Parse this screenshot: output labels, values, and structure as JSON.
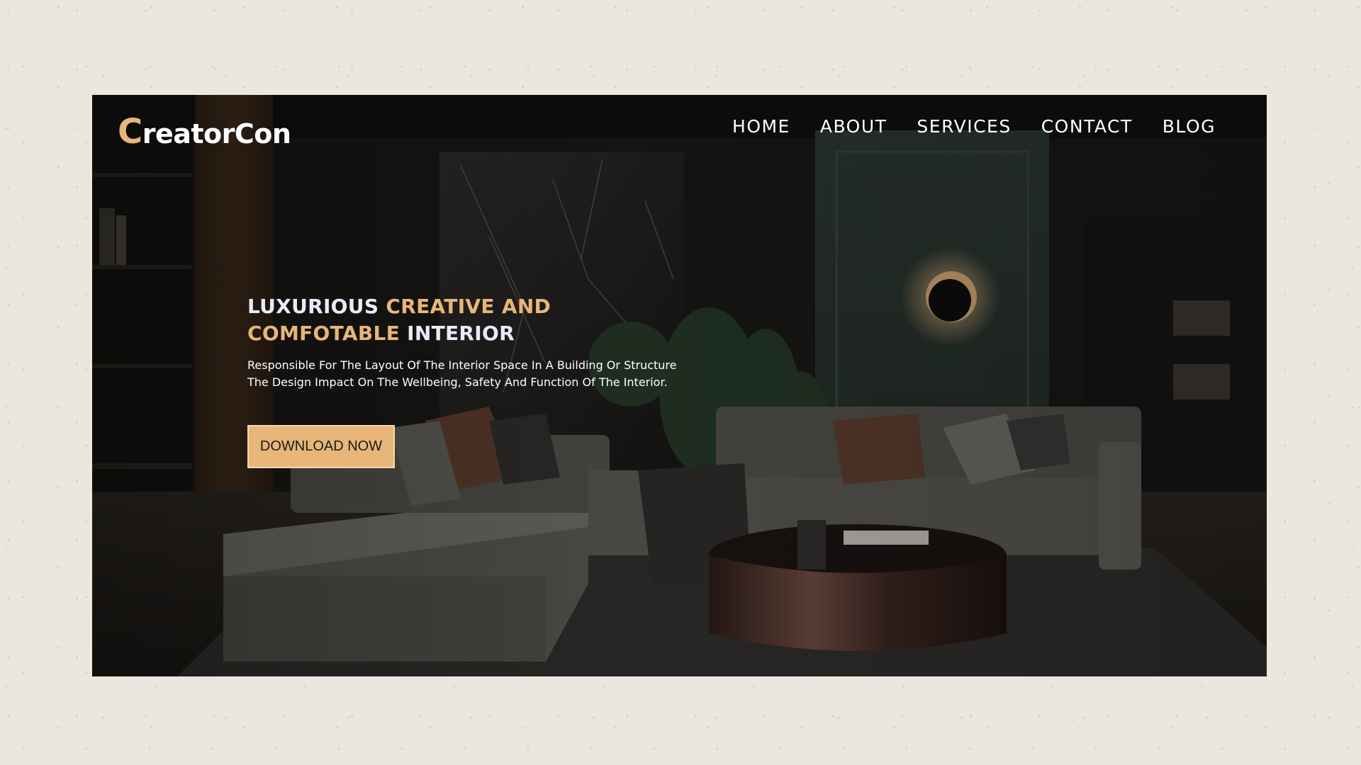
{
  "brand": {
    "initial": "C",
    "rest": "reatorCon",
    "accent_color": "#e7b678"
  },
  "nav": {
    "items": [
      {
        "label": "HOME"
      },
      {
        "label": "ABOUT"
      },
      {
        "label": "SERVICES"
      },
      {
        "label": "CONTACT"
      },
      {
        "label": "BLOG"
      }
    ]
  },
  "hero": {
    "title_line1_a": "LUXURIOUS",
    "title_line1_b": "CREATIVE AND",
    "title_line2_a": "COMFOTABLE",
    "title_line2_b": "INTERIOR",
    "description_line1": "Responsible For The Layout Of The Interior Space In A Building Or Structure",
    "description_line2": "The Design Impact On The Wellbeing, Safety And Function Of The Interior.",
    "cta_label": "DOWNLOAD NOW",
    "title_light_color": "#e8ecf8",
    "title_accent_color": "#e7b678"
  },
  "background": {
    "icon": "living-room-photo",
    "page_color": "#ebe6de"
  }
}
